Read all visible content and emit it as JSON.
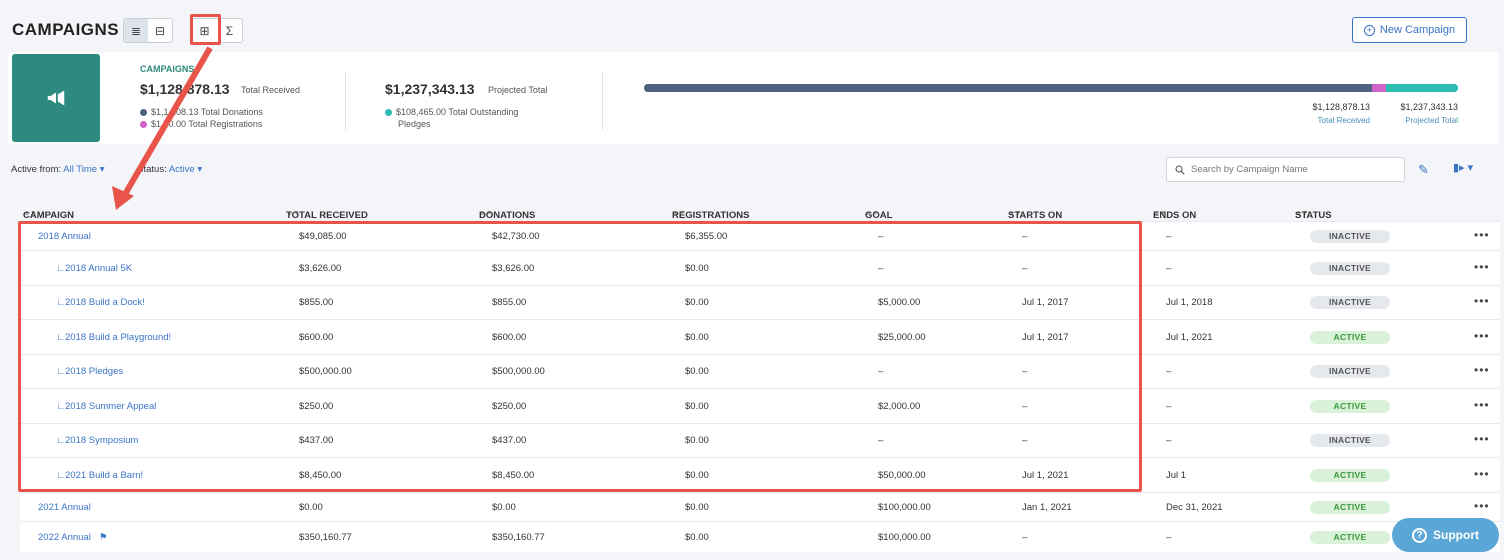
{
  "header": {
    "title": "CAMPAIGNS",
    "view_buttons": [
      "≣",
      "⊟"
    ],
    "view_buttons_2": [
      "⊞",
      "Σ"
    ],
    "new_campaign_label": "New Campaign"
  },
  "summary": {
    "label": "CAMPAIGNS",
    "total_received": "$1,128,878.13",
    "total_received_label": "Total Received",
    "donations_line": "$1,1 208.13 Total Donations",
    "registrations_line": "$1 70.00 Total Registrations",
    "projected_total": "$1,237,343.13",
    "projected_total_label": "Projected Total",
    "pledges_line_1": "$108,465.00 Total Outstanding",
    "pledges_line_2": "Pledges",
    "progress": {
      "donations_fraction": 0.894,
      "registrations_fraction": 0.018,
      "pledges_fraction": 0.088
    },
    "bar_received_value": "$1,128,878.13",
    "bar_received_label": "Total Received",
    "bar_projected_value": "$1,237,343.13",
    "bar_projected_label": "Projected Total",
    "colors": {
      "donations": "#4f5f80",
      "registrations": "#d065c7",
      "pledges": "#2ebdb3"
    }
  },
  "filters": {
    "active_from_label": "Active from:",
    "active_from_value": "All Time",
    "status_label": "Status:",
    "status_value": "Active",
    "search_placeholder": "Search by Campaign Name"
  },
  "table": {
    "headers": [
      "CAMPAIGN",
      "TOTAL RECEIVED",
      "DONATIONS",
      "REGISTRATIONS",
      "GOAL",
      "STARTS ON",
      "ENDS ON",
      "STATUS"
    ],
    "rows": [
      {
        "name": "2018 Annual",
        "child": false,
        "received": "$49,085.00",
        "donations": "$42,730.00",
        "registrations": "$6,355.00",
        "goal": "–",
        "starts": "–",
        "ends": "–",
        "status": "INACTIVE"
      },
      {
        "name": "2018 Annual 5K",
        "child": true,
        "received": "$3,626.00",
        "donations": "$3,626.00",
        "registrations": "$0.00",
        "goal": "–",
        "starts": "–",
        "ends": "–",
        "status": "INACTIVE"
      },
      {
        "name": "2018 Build a Dock!",
        "child": true,
        "received": "$855.00",
        "donations": "$855.00",
        "registrations": "$0.00",
        "goal": "$5,000.00",
        "starts": "Jul 1, 2017",
        "ends": "Jul 1, 2018",
        "status": "INACTIVE"
      },
      {
        "name": "2018 Build a Playground!",
        "child": true,
        "received": "$600.00",
        "donations": "$600.00",
        "registrations": "$0.00",
        "goal": "$25,000.00",
        "starts": "Jul 1, 2017",
        "ends": "Jul 1, 2021",
        "status": "ACTIVE"
      },
      {
        "name": "2018 Pledges",
        "child": true,
        "received": "$500,000.00",
        "donations": "$500,000.00",
        "registrations": "$0.00",
        "goal": "–",
        "starts": "–",
        "ends": "–",
        "status": "INACTIVE"
      },
      {
        "name": "2018 Summer Appeal",
        "child": true,
        "received": "$250.00",
        "donations": "$250.00",
        "registrations": "$0.00",
        "goal": "$2,000.00",
        "starts": "–",
        "ends": "–",
        "status": "ACTIVE"
      },
      {
        "name": "2018 Symposium",
        "child": true,
        "received": "$437.00",
        "donations": "$437.00",
        "registrations": "$0.00",
        "goal": "–",
        "starts": "–",
        "ends": "–",
        "status": "INACTIVE"
      },
      {
        "name": "2021 Build a Barn!",
        "child": true,
        "received": "$8,450.00",
        "donations": "$8,450.00",
        "registrations": "$0.00",
        "goal": "$50,000.00",
        "starts": "Jul 1, 2021",
        "ends": "Jul 1",
        "status": "ACTIVE"
      },
      {
        "name": "2021 Annual",
        "child": false,
        "received": "$0.00",
        "donations": "$0.00",
        "registrations": "$0.00",
        "goal": "$100,000.00",
        "starts": "Jan 1, 2021",
        "ends": "Dec 31, 2021",
        "status": "ACTIVE"
      },
      {
        "name": "2022 Annual",
        "child": false,
        "flag": true,
        "received": "$350,160.77",
        "donations": "$350,160.77",
        "registrations": "$0.00",
        "goal": "$100,000.00",
        "starts": "–",
        "ends": "–",
        "status": "ACTIVE"
      }
    ]
  },
  "support_label": "Support"
}
